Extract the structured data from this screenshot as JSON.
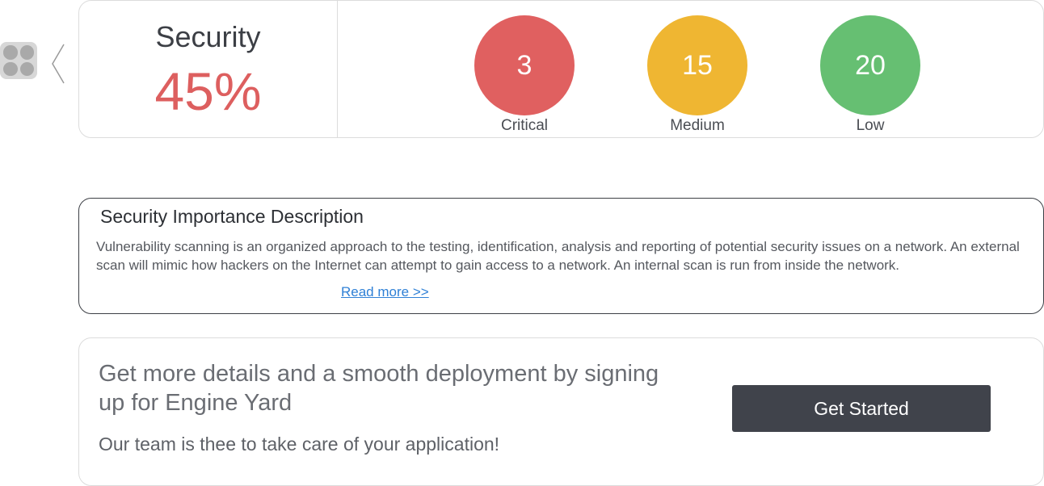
{
  "colors": {
    "critical": "#e06060",
    "medium": "#efb632",
    "low": "#66bf72",
    "score": "#dd5f5f",
    "button": "#40434b",
    "link": "#2f80d6"
  },
  "nav": {
    "apps_icon": "apps-grid-icon",
    "back_icon": "chevron-left-icon"
  },
  "summary": {
    "title": "Security",
    "score": "45%",
    "severities": [
      {
        "count": "3",
        "label": "Critical"
      },
      {
        "count": "15",
        "label": "Medium"
      },
      {
        "count": "20",
        "label": "Low"
      }
    ]
  },
  "description": {
    "title": "Security Importance Description",
    "body": "Vulnerability scanning is an organized approach to the testing, identification, analysis and reporting of potential security issues on a network. An external scan will mimic how hackers on the Internet can attempt to gain access to a network. An internal scan is run from inside the network.",
    "read_more": "Read more >>"
  },
  "cta": {
    "heading": "Get more details and a smooth deployment by signing up for Engine Yard",
    "subtext": "Our team is thee to take care of your application!",
    "button_label": "Get Started"
  }
}
